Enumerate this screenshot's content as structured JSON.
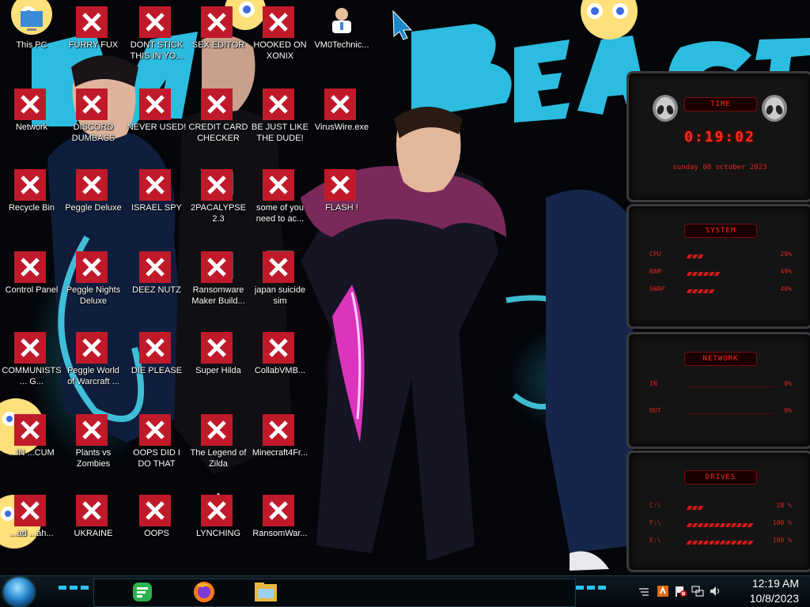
{
  "desktop": {
    "icons": [
      {
        "label": "This PC",
        "name": "this-pc-icon"
      },
      {
        "label": "FURRY FUX",
        "name": "firefox-icon"
      },
      {
        "label": "DONT STICK THIS IN YO...",
        "name": "vlc-icon"
      },
      {
        "label": "SEX EDITOR",
        "name": "notepad-icon"
      },
      {
        "label": "HOOKED ON XONIX",
        "name": "xonix-icon"
      },
      {
        "label": "VM0Technic...",
        "name": "technician-icon"
      },
      {
        "label": "Network",
        "name": "network-icon"
      },
      {
        "label": "DISCORD DUMBASS",
        "name": "discord-icon"
      },
      {
        "label": "NEVER USED!",
        "name": "devcpp-icon"
      },
      {
        "label": "CREDIT CARD CHECKER",
        "name": "credit-card-icon"
      },
      {
        "label": "BE JUST LIKE THE DUDE!",
        "name": "santa-icon"
      },
      {
        "label": "VirusWire.exe",
        "name": "lime-icon"
      },
      {
        "label": "Recycle Bin",
        "name": "recycle-bin-icon"
      },
      {
        "label": "Peggle Deluxe",
        "name": "peggle-icon"
      },
      {
        "label": "ISRAEL SPY",
        "name": "spy-icon"
      },
      {
        "label": "2PACALYPSE 2.3",
        "name": "terminal-icon"
      },
      {
        "label": "some of you need to ac...",
        "name": "beaver-icon"
      },
      {
        "label": "FLASH !",
        "name": "flash-icon"
      },
      {
        "label": "Control Panel",
        "name": "control-panel-icon"
      },
      {
        "label": "Peggle Nights Deluxe",
        "name": "peggle-nights-icon"
      },
      {
        "label": "DEEZ NUTZ",
        "name": "windows-stack-icon"
      },
      {
        "label": "Ransomware Maker Build...",
        "name": "ransomware-icon"
      },
      {
        "label": "japan suicide sim",
        "name": "japan-sim-icon"
      },
      {
        "label": "COMMUNISTS ... G...",
        "name": "money-bag-icon"
      },
      {
        "label": "Peggle World of Warcraft ...",
        "name": "peggle-wow-icon"
      },
      {
        "label": "DIE PLEASE",
        "name": "die-icon"
      },
      {
        "label": "Super Hilda",
        "name": "super-hilda-icon"
      },
      {
        "label": "CollabVMB...",
        "name": "collabvm-icon"
      },
      {
        "label": "...IN ...CUM",
        "name": "cartoon-icon"
      },
      {
        "label": "Plants vs Zombies",
        "name": "pvz-icon"
      },
      {
        "label": "OOPS DID I DO THAT",
        "name": "portrait-icon"
      },
      {
        "label": "The Legend of Zilda",
        "name": "zelda-icon"
      },
      {
        "label": "Minecraft4Fr...",
        "name": "minecraft-icon"
      },
      {
        "label": "...ad ...ah...",
        "name": "cartoon2-icon"
      },
      {
        "label": "UKRAINE",
        "name": "radiation-icon"
      },
      {
        "label": "OOPS",
        "name": "oops-icon"
      },
      {
        "label": "LYNCHING",
        "name": "lynching-icon"
      },
      {
        "label": "RansomWar...",
        "name": "skull-icon"
      }
    ]
  },
  "gadgets": {
    "time": {
      "title": "TIME",
      "clock": "0:19:02",
      "date": "sunday 08 october 2023"
    },
    "system": {
      "title": "SYSTEM",
      "rows": [
        {
          "key": "CPU",
          "value": "29%",
          "level": 0.29
        },
        {
          "key": "RAM",
          "value": "49%",
          "level": 0.49
        },
        {
          "key": "SWAP",
          "value": "40%",
          "level": 0.4
        }
      ]
    },
    "network": {
      "title": "NETWORK",
      "rows": [
        {
          "key": "IN",
          "value": "0%"
        },
        {
          "key": "OUT",
          "value": "0%"
        }
      ]
    },
    "drives": {
      "title": "DRIVES",
      "rows": [
        {
          "key": "C:\\",
          "value": "28 %",
          "level": 0.28
        },
        {
          "key": "F:\\",
          "value": "100 %",
          "level": 1.0
        },
        {
          "key": "E:\\",
          "value": "100 %",
          "level": 1.0
        }
      ]
    }
  },
  "taskbar": {
    "pinned": [
      {
        "name": "feedly-taskbar-icon"
      },
      {
        "name": "firefox-taskbar-icon"
      },
      {
        "name": "file-explorer-taskbar-icon"
      }
    ],
    "clock_time": "12:19 AM",
    "clock_date": "10/8/2023"
  },
  "colors": {
    "accent": "#ff2a1a",
    "wallpaper_cyan": "#2ed4ff",
    "wallpaper_magenta": "#e02a90"
  }
}
